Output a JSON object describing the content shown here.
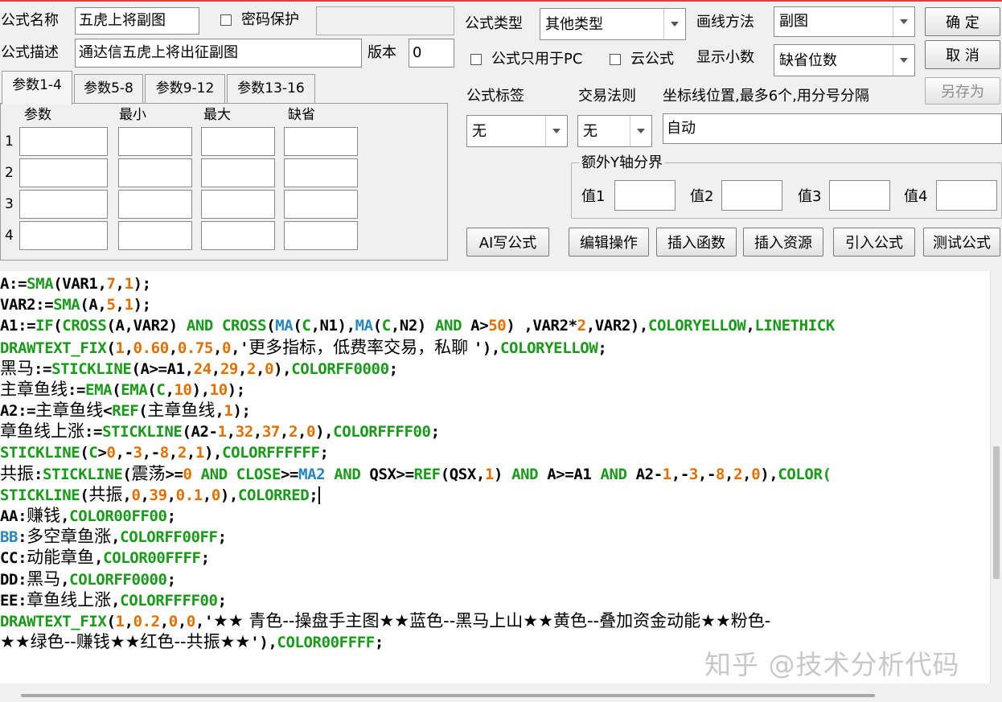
{
  "colors": {
    "keyword": "#000000",
    "function": "#1a9a1a",
    "number": "#e07000",
    "blue": "#2686c0",
    "window_bg": "#f0f0f0",
    "top_border": "#d94040"
  },
  "form": {
    "name_label": "公式名称",
    "name_value": "五虎上将副图",
    "password_label": "密码保护",
    "password_value": "",
    "desc_label": "公式描述",
    "desc_value": "通达信五虎上将出征副图",
    "version_label": "版本",
    "version_value": "0",
    "type_label": "公式类型",
    "type_value": "其他类型",
    "draw_label": "画线方法",
    "draw_value": "副图",
    "pc_only_label": "公式只用于PC",
    "cloud_label": "云公式",
    "decimal_label": "显示小数",
    "decimal_value": "缺省位数",
    "tag_label": "公式标签",
    "tag_value": "无",
    "rule_label": "交易法则",
    "rule_value": "无",
    "coord_label": "坐标线位置,最多6个,用分号分隔",
    "coord_value": "自动",
    "extra_y_label": "额外Y轴分界",
    "val1_label": "值1",
    "val2_label": "值2",
    "val3_label": "值3",
    "val4_label": "值4"
  },
  "buttons": {
    "ok": "确  定",
    "cancel": "取  消",
    "save_as": "另存为",
    "ai": "AI写公式",
    "edit": "编辑操作",
    "insert_func": "插入函数",
    "insert_res": "插入资源",
    "import": "引入公式",
    "test": "测试公式"
  },
  "params": {
    "tabs": [
      "参数1-4",
      "参数5-8",
      "参数9-12",
      "参数13-16"
    ],
    "headers": [
      "参数",
      "最小",
      "最大",
      "缺省"
    ],
    "rows": [
      "1",
      "2",
      "3",
      "4"
    ]
  },
  "code_lines": [
    [
      [
        "k",
        "A:="
      ],
      [
        "f",
        "SMA"
      ],
      [
        "k",
        "(VAR1,"
      ],
      [
        "n",
        "7"
      ],
      [
        "k",
        ","
      ],
      [
        "n",
        "1"
      ],
      [
        "k",
        ");"
      ]
    ],
    [
      [
        "k",
        "VAR2:="
      ],
      [
        "f",
        "SMA"
      ],
      [
        "k",
        "(A,"
      ],
      [
        "n",
        "5"
      ],
      [
        "k",
        ","
      ],
      [
        "n",
        "1"
      ],
      [
        "k",
        ");"
      ]
    ],
    [
      [
        "k",
        "A1:="
      ],
      [
        "f",
        "IF"
      ],
      [
        "k",
        "("
      ],
      [
        "f",
        "CROSS"
      ],
      [
        "k",
        "(A,VAR2) "
      ],
      [
        "f",
        "AND"
      ],
      [
        "k",
        " "
      ],
      [
        "f",
        "CROSS"
      ],
      [
        "k",
        "("
      ],
      [
        "b",
        "MA"
      ],
      [
        "k",
        "("
      ],
      [
        "f",
        "C"
      ],
      [
        "k",
        ",N1),"
      ],
      [
        "b",
        "MA"
      ],
      [
        "k",
        "("
      ],
      [
        "f",
        "C"
      ],
      [
        "k",
        ",N2) "
      ],
      [
        "f",
        "AND"
      ],
      [
        "k",
        " A>"
      ],
      [
        "n",
        "50"
      ],
      [
        "k",
        ") ,VAR2*"
      ],
      [
        "n",
        "2"
      ],
      [
        "k",
        ",VAR2),"
      ],
      [
        "f",
        "COLORYELLOW"
      ],
      [
        "k",
        ","
      ],
      [
        "f",
        "LINETHICK"
      ]
    ],
    [
      [
        "f",
        "DRAWTEXT_FIX"
      ],
      [
        "k",
        "("
      ],
      [
        "n",
        "1"
      ],
      [
        "k",
        ","
      ],
      [
        "n",
        "0.60"
      ],
      [
        "k",
        ","
      ],
      [
        "n",
        "0.75"
      ],
      [
        "k",
        ","
      ],
      [
        "n",
        "0"
      ],
      [
        "k",
        ",'"
      ],
      [
        "cn",
        "更多指标，低费率交易，私聊 "
      ],
      [
        "k",
        "'),"
      ],
      [
        "f",
        "COLORYELLOW"
      ],
      [
        "k",
        ";"
      ]
    ],
    [
      [
        "cn",
        "黑马"
      ],
      [
        "k",
        ":="
      ],
      [
        "f",
        "STICKLINE"
      ],
      [
        "k",
        "(A>=A1,"
      ],
      [
        "n",
        "24"
      ],
      [
        "k",
        ","
      ],
      [
        "n",
        "29"
      ],
      [
        "k",
        ","
      ],
      [
        "n",
        "2"
      ],
      [
        "k",
        ","
      ],
      [
        "n",
        "0"
      ],
      [
        "k",
        "),"
      ],
      [
        "f",
        "COLORFF0000"
      ],
      [
        "k",
        ";"
      ]
    ],
    [
      [
        "cn",
        "主章鱼线"
      ],
      [
        "k",
        ":="
      ],
      [
        "f",
        "EMA"
      ],
      [
        "k",
        "("
      ],
      [
        "f",
        "EMA"
      ],
      [
        "k",
        "("
      ],
      [
        "f",
        "C"
      ],
      [
        "k",
        ","
      ],
      [
        "n",
        "10"
      ],
      [
        "k",
        "),"
      ],
      [
        "n",
        "10"
      ],
      [
        "k",
        ");"
      ]
    ],
    [
      [
        "k",
        "A2:="
      ],
      [
        "cn",
        "主章鱼线"
      ],
      [
        "k",
        "<"
      ],
      [
        "f",
        "REF"
      ],
      [
        "k",
        "("
      ],
      [
        "cn",
        "主章鱼线"
      ],
      [
        "k",
        ","
      ],
      [
        "n",
        "1"
      ],
      [
        "k",
        ");"
      ]
    ],
    [
      [
        "cn",
        "章鱼线上涨"
      ],
      [
        "k",
        ":="
      ],
      [
        "f",
        "STICKLINE"
      ],
      [
        "k",
        "(A2-"
      ],
      [
        "n",
        "1"
      ],
      [
        "k",
        ","
      ],
      [
        "n",
        "32"
      ],
      [
        "k",
        ","
      ],
      [
        "n",
        "37"
      ],
      [
        "k",
        ","
      ],
      [
        "n",
        "2"
      ],
      [
        "k",
        ","
      ],
      [
        "n",
        "0"
      ],
      [
        "k",
        "),"
      ],
      [
        "f",
        "COLORFFFF00"
      ],
      [
        "k",
        ";"
      ]
    ],
    [
      [
        "f",
        "STICKLINE"
      ],
      [
        "k",
        "("
      ],
      [
        "f",
        "C"
      ],
      [
        "k",
        ">"
      ],
      [
        "n",
        "0"
      ],
      [
        "k",
        ",-"
      ],
      [
        "n",
        "3"
      ],
      [
        "k",
        ",-"
      ],
      [
        "n",
        "8"
      ],
      [
        "k",
        ","
      ],
      [
        "n",
        "2"
      ],
      [
        "k",
        ","
      ],
      [
        "n",
        "1"
      ],
      [
        "k",
        "),"
      ],
      [
        "f",
        "COLORFFFFFF"
      ],
      [
        "k",
        ";"
      ]
    ],
    [
      [
        "cn",
        "共振"
      ],
      [
        "k",
        ":"
      ],
      [
        "f",
        "STICKLINE"
      ],
      [
        "k",
        "("
      ],
      [
        "cn",
        "震荡"
      ],
      [
        "k",
        ">="
      ],
      [
        "n",
        "0"
      ],
      [
        "k",
        " "
      ],
      [
        "f",
        "AND"
      ],
      [
        "k",
        " "
      ],
      [
        "f",
        "CLOSE"
      ],
      [
        "k",
        ">="
      ],
      [
        "b",
        "MA2"
      ],
      [
        "k",
        " "
      ],
      [
        "f",
        "AND"
      ],
      [
        "k",
        " QSX>="
      ],
      [
        "f",
        "REF"
      ],
      [
        "k",
        "(QSX,"
      ],
      [
        "n",
        "1"
      ],
      [
        "k",
        ") "
      ],
      [
        "f",
        "AND"
      ],
      [
        "k",
        " A>=A1 "
      ],
      [
        "f",
        "AND"
      ],
      [
        "k",
        " A2-"
      ],
      [
        "n",
        "1"
      ],
      [
        "k",
        ",-"
      ],
      [
        "n",
        "3"
      ],
      [
        "k",
        ",-"
      ],
      [
        "n",
        "8"
      ],
      [
        "k",
        ","
      ],
      [
        "n",
        "2"
      ],
      [
        "k",
        ","
      ],
      [
        "n",
        "0"
      ],
      [
        "k",
        "),"
      ],
      [
        "f",
        "COLOR("
      ]
    ],
    [
      [
        "f",
        "STICKLINE"
      ],
      [
        "k",
        "("
      ],
      [
        "cn",
        "共振"
      ],
      [
        "k",
        ","
      ],
      [
        "n",
        "0"
      ],
      [
        "k",
        ","
      ],
      [
        "n",
        "39"
      ],
      [
        "k",
        ","
      ],
      [
        "n",
        "0.1"
      ],
      [
        "k",
        ","
      ],
      [
        "n",
        "0"
      ],
      [
        "k",
        "),"
      ],
      [
        "f",
        "COLORRED"
      ],
      [
        "k",
        ";"
      ]
    ],
    [
      [
        "k",
        "AA:"
      ],
      [
        "cn",
        "赚钱"
      ],
      [
        "k",
        ","
      ],
      [
        "f",
        "COLOR00FF00"
      ],
      [
        "k",
        ";"
      ]
    ],
    [
      [
        "b",
        "BB"
      ],
      [
        "k",
        ":"
      ],
      [
        "cn",
        "多空章鱼涨"
      ],
      [
        "k",
        ","
      ],
      [
        "f",
        "COLORFF00FF"
      ],
      [
        "k",
        ";"
      ]
    ],
    [
      [
        "k",
        "CC:"
      ],
      [
        "cn",
        "动能章鱼"
      ],
      [
        "k",
        ","
      ],
      [
        "f",
        "COLOR00FFFF"
      ],
      [
        "k",
        ";"
      ]
    ],
    [
      [
        "k",
        "DD:"
      ],
      [
        "cn",
        "黑马"
      ],
      [
        "k",
        ","
      ],
      [
        "f",
        "COLORFF0000"
      ],
      [
        "k",
        ";"
      ]
    ],
    [
      [
        "k",
        "EE:"
      ],
      [
        "cn",
        "章鱼线上涨"
      ],
      [
        "k",
        ","
      ],
      [
        "f",
        "COLORFFFF00"
      ],
      [
        "k",
        ";"
      ]
    ],
    [
      [
        "f",
        "DRAWTEXT_FIX"
      ],
      [
        "k",
        "("
      ],
      [
        "n",
        "1"
      ],
      [
        "k",
        ","
      ],
      [
        "n",
        "0.2"
      ],
      [
        "k",
        ","
      ],
      [
        "n",
        "0"
      ],
      [
        "k",
        ","
      ],
      [
        "n",
        "0"
      ],
      [
        "k",
        ",'"
      ],
      [
        "cn",
        "★★ 青色--操盘手主图★★蓝色--黑马上山★★黄色--叠加资金动能★★粉色-"
      ]
    ],
    [
      [
        "cn",
        "★★绿色--赚钱★★红色--共振★★"
      ],
      [
        "k",
        "'),"
      ],
      [
        "f",
        "COLOR00FFFF"
      ],
      [
        "k",
        ";"
      ]
    ]
  ],
  "caret_line": 10,
  "watermark": "知乎 @技术分析代码"
}
